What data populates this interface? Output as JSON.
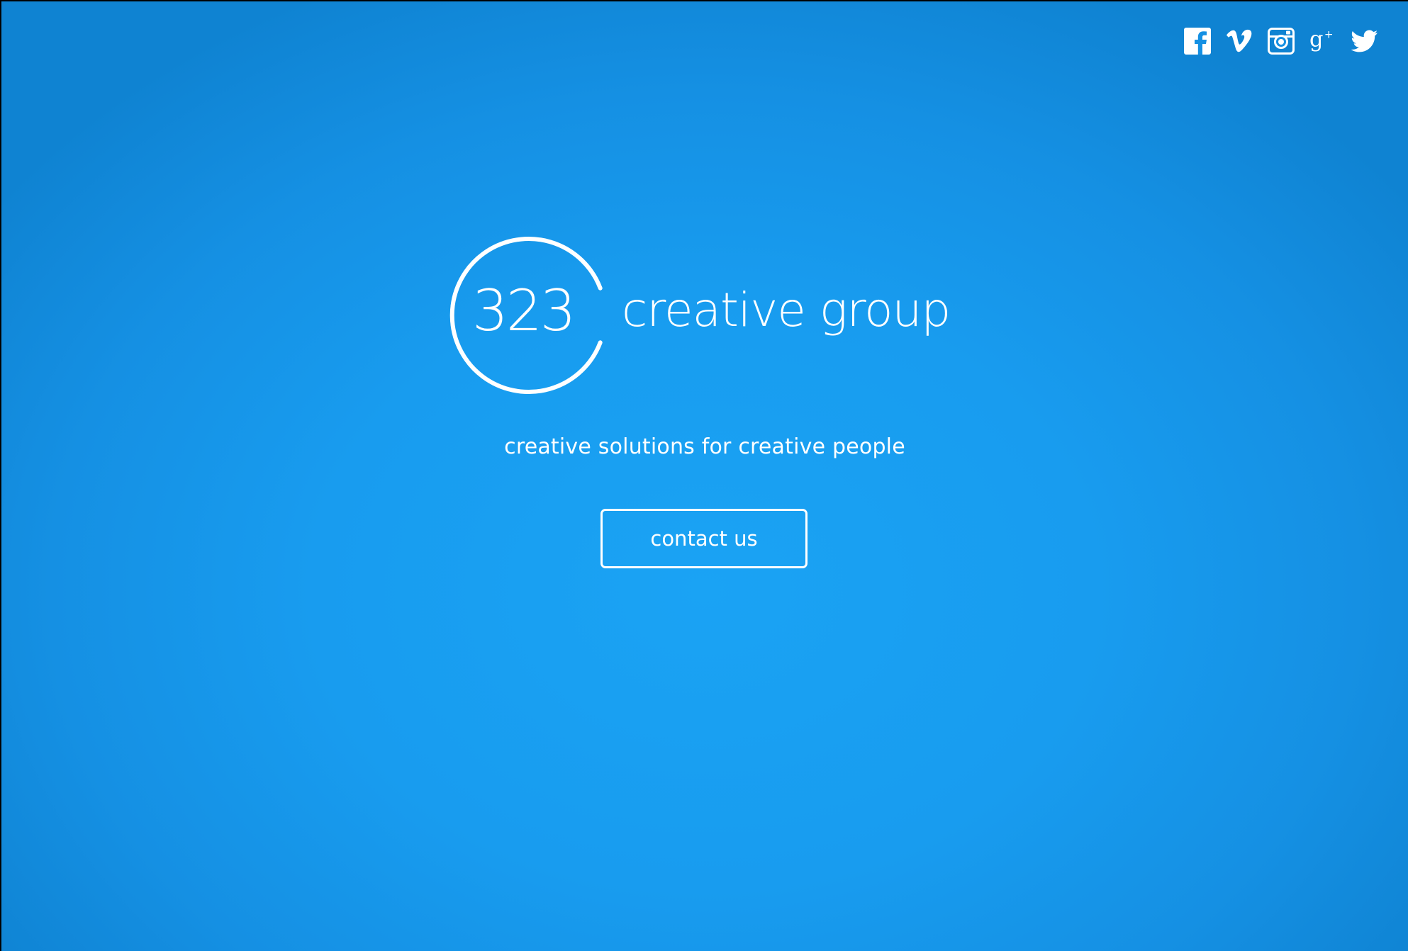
{
  "header": {
    "social_links": [
      {
        "name": "facebook-icon",
        "label": "Facebook"
      },
      {
        "name": "vimeo-icon",
        "label": "Vimeo"
      },
      {
        "name": "instagram-icon",
        "label": "Instagram"
      },
      {
        "name": "google-plus-icon",
        "label": "Google+"
      },
      {
        "name": "twitter-icon",
        "label": "Twitter"
      }
    ]
  },
  "brand": {
    "number": "323",
    "name": "creative group"
  },
  "hero": {
    "tagline": "creative solutions for creative people",
    "cta_label": "contact us"
  },
  "colors": {
    "background_center": "#1aa3f4",
    "background_edge": "#0f83d2",
    "foreground": "#ffffff"
  }
}
